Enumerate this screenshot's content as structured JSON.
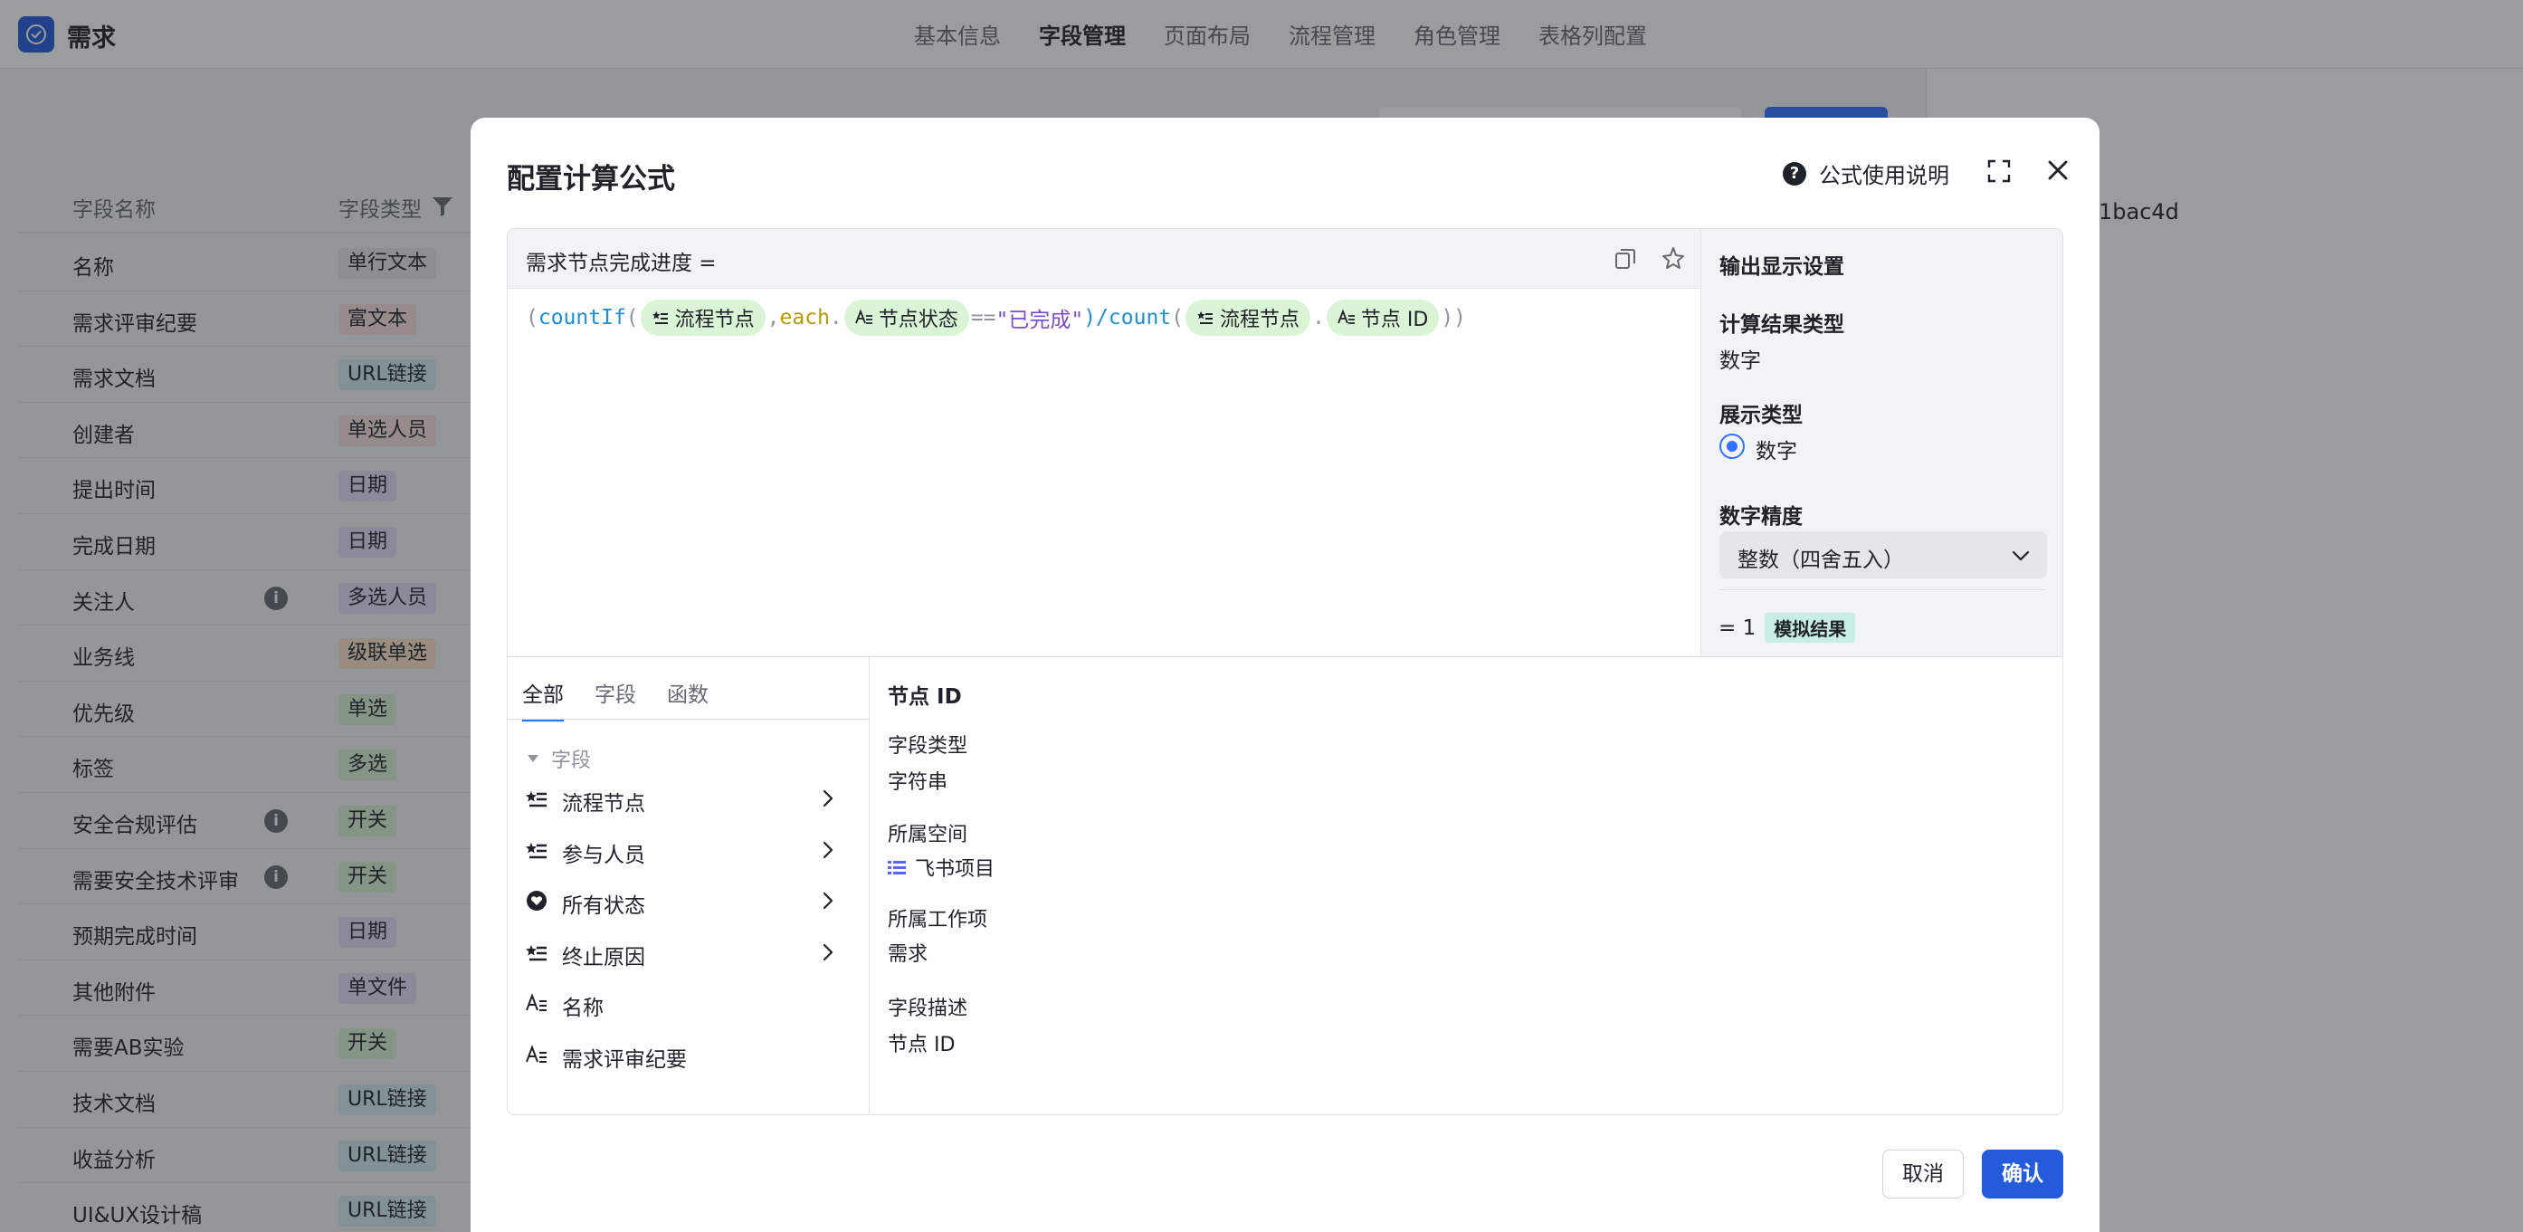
{
  "app": {
    "name": "需求"
  },
  "top_nav": [
    "基本信息",
    "字段管理",
    "页面布局",
    "流程管理",
    "角色管理",
    "表格列配置"
  ],
  "top_nav_active": 1,
  "bg_table": {
    "col_name": "字段名称",
    "col_type": "字段类型",
    "rows": [
      {
        "name": "名称",
        "type": "单行文本",
        "color": "#e3e6ea",
        "fg": "#1f2329",
        "info": false
      },
      {
        "name": "需求评审纪要",
        "type": "富文本",
        "color": "#fbe0dc",
        "fg": "#1f2329",
        "info": false
      },
      {
        "name": "需求文档",
        "type": "URL链接",
        "color": "#d5ecf3",
        "fg": "#1f2329",
        "info": false
      },
      {
        "name": "创建者",
        "type": "单选人员",
        "color": "#fbe0dc",
        "fg": "#1f2329",
        "info": false
      },
      {
        "name": "提出时间",
        "type": "日期",
        "color": "#e1e0f5",
        "fg": "#1f2329",
        "info": false
      },
      {
        "name": "完成日期",
        "type": "日期",
        "color": "#e1e0f5",
        "fg": "#1f2329",
        "info": false
      },
      {
        "name": "关注人",
        "type": "多选人员",
        "color": "#e1e0f5",
        "fg": "#1f2329",
        "info": true
      },
      {
        "name": "业务线",
        "type": "级联单选",
        "color": "#fbe3c8",
        "fg": "#1f2329",
        "info": false
      },
      {
        "name": "优先级",
        "type": "单选",
        "color": "#d9f1d2",
        "fg": "#1f2329",
        "info": false
      },
      {
        "name": "标签",
        "type": "多选",
        "color": "#d9f1d2",
        "fg": "#1f2329",
        "info": false
      },
      {
        "name": "安全合规评估",
        "type": "开关",
        "color": "#d9f1d2",
        "fg": "#1f2329",
        "info": true
      },
      {
        "name": "需要安全技术评审",
        "type": "开关",
        "color": "#d9f1d2",
        "fg": "#1f2329",
        "info": true
      },
      {
        "name": "预期完成时间",
        "type": "日期",
        "color": "#e1e0f5",
        "fg": "#1f2329",
        "info": false
      },
      {
        "name": "其他附件",
        "type": "单文件",
        "color": "#e1e0f5",
        "fg": "#1f2329",
        "info": false
      },
      {
        "name": "需要AB实验",
        "type": "开关",
        "color": "#d9f1d2",
        "fg": "#1f2329",
        "info": false
      },
      {
        "name": "技术文档",
        "type": "URL链接",
        "color": "#d5ecf3",
        "fg": "#1f2329",
        "info": false
      },
      {
        "name": "收益分析",
        "type": "URL链接",
        "color": "#d5ecf3",
        "fg": "#1f2329",
        "info": false
      },
      {
        "name": "UI&UX设计稿",
        "type": "URL链接",
        "color": "#d5ecf3",
        "fg": "#1f2329",
        "info": false
      }
    ]
  },
  "bg_right": {
    "hash_fragment": "1bac4d"
  },
  "modal": {
    "title": "配置计算公式",
    "help_label": "公式使用说明",
    "formula_label": "需求节点完成进度 =",
    "formula": {
      "open": "(",
      "fn1": "countIf",
      "chip1": "流程节点",
      "comma": ",",
      "each": "each",
      "dot": ".",
      "chip2": "节点状态",
      "eq": "==",
      "str": "\"已完成\"",
      "close_div": ")/",
      "fn2": "count",
      "chip3": "流程节点",
      "chip4": "节点 ID",
      "end": "))"
    },
    "settings": {
      "title": "输出显示设置",
      "result_type_label": "计算结果类型",
      "result_type_value": "数字",
      "display_type_label": "展示类型",
      "display_type_option": "数字",
      "precision_label": "数字精度",
      "precision_value": "整数（四舍五入）",
      "sim_value": "= 1",
      "sim_badge": "模拟结果"
    },
    "tabs": [
      "全部",
      "字段",
      "函数"
    ],
    "group_label": "字段",
    "fields": [
      {
        "label": "流程节点",
        "icon": "list-star-icon",
        "chevron": true
      },
      {
        "label": "参与人员",
        "icon": "list-star-icon",
        "chevron": true
      },
      {
        "label": "所有状态",
        "icon": "heart-status-icon",
        "chevron": true
      },
      {
        "label": "终止原因",
        "icon": "list-star-icon",
        "chevron": true
      },
      {
        "label": "名称",
        "icon": "text-field-icon",
        "chevron": false
      },
      {
        "label": "需求评审纪要",
        "icon": "text-field-icon",
        "chevron": false
      }
    ],
    "detail": {
      "title": "节点 ID",
      "type_label": "字段类型",
      "type_value": "字符串",
      "space_label": "所属空间",
      "space_value": "飞书项目",
      "work_label": "所属工作项",
      "work_value": "需求",
      "desc_label": "字段描述",
      "desc_value": "节点 ID"
    },
    "cancel": "取消",
    "confirm": "确认"
  },
  "colors": {
    "accent": "#245bdb",
    "chip_bg": "#d9f5d6",
    "sim_badge_bg": "#c8ede3"
  }
}
